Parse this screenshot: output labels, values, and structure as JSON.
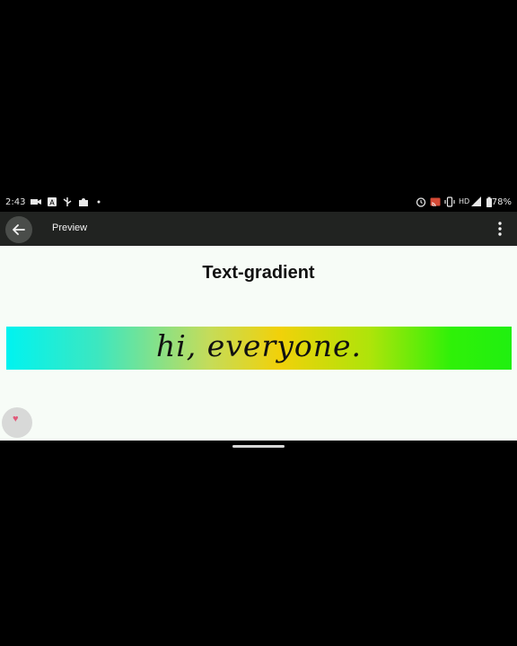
{
  "status_bar": {
    "time": "2:43",
    "battery": "78%",
    "network_label": "HD",
    "left_icons": [
      "video-camera-icon",
      "text-a-icon",
      "usb-icon",
      "puzzle-icon",
      "dot-icon"
    ],
    "right_icons": [
      "alarm-icon",
      "cast-icon",
      "vibrate-icon",
      "hd-icon",
      "signal-icon",
      "battery-icon"
    ]
  },
  "app_bar": {
    "title": "Preview",
    "back_icon": "arrow-left-icon",
    "menu_icon": "more-vertical-icon"
  },
  "content": {
    "heading": "Text-gradient",
    "banner_text": "hi, everyone.",
    "banner_colors": [
      "#00f3f0",
      "#f1d10a",
      "#20f010"
    ]
  },
  "floating_bubble": {
    "icon": "heart-icon"
  },
  "colors": {
    "app_bar_bg": "#212321",
    "content_bg": "#f7fcf7",
    "outer_bg": "#000000"
  }
}
